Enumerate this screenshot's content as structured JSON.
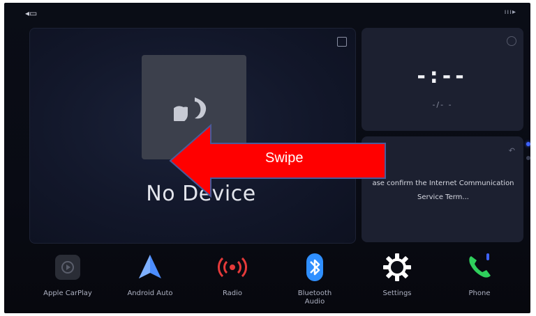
{
  "status": {
    "left_icon": "phone-mirror-icon",
    "right_icon": "signal-icon"
  },
  "media": {
    "status_text": "No Device",
    "album_icon": "music-logo-icon"
  },
  "clock": {
    "time": "-:--",
    "date": "-/- -"
  },
  "message": {
    "text": "ase confirm the Internet Communication Service Term..."
  },
  "overlay": {
    "label": "Swipe",
    "color": "#ff0000"
  },
  "dock": [
    {
      "label": "Apple CarPlay",
      "icon": "carplay-icon"
    },
    {
      "label": "Android Auto",
      "icon": "android-auto-icon"
    },
    {
      "label": "Radio",
      "icon": "radio-icon"
    },
    {
      "label": "Bluetooth Audio",
      "icon": "bluetooth-icon"
    },
    {
      "label": "Settings",
      "icon": "gear-icon"
    },
    {
      "label": "Phone",
      "icon": "phone-icon"
    }
  ],
  "colors": {
    "accent": "#3e63ff",
    "radio": "#e53a3a",
    "bluetooth": "#2f8fff",
    "phone": "#2fcf5c"
  }
}
